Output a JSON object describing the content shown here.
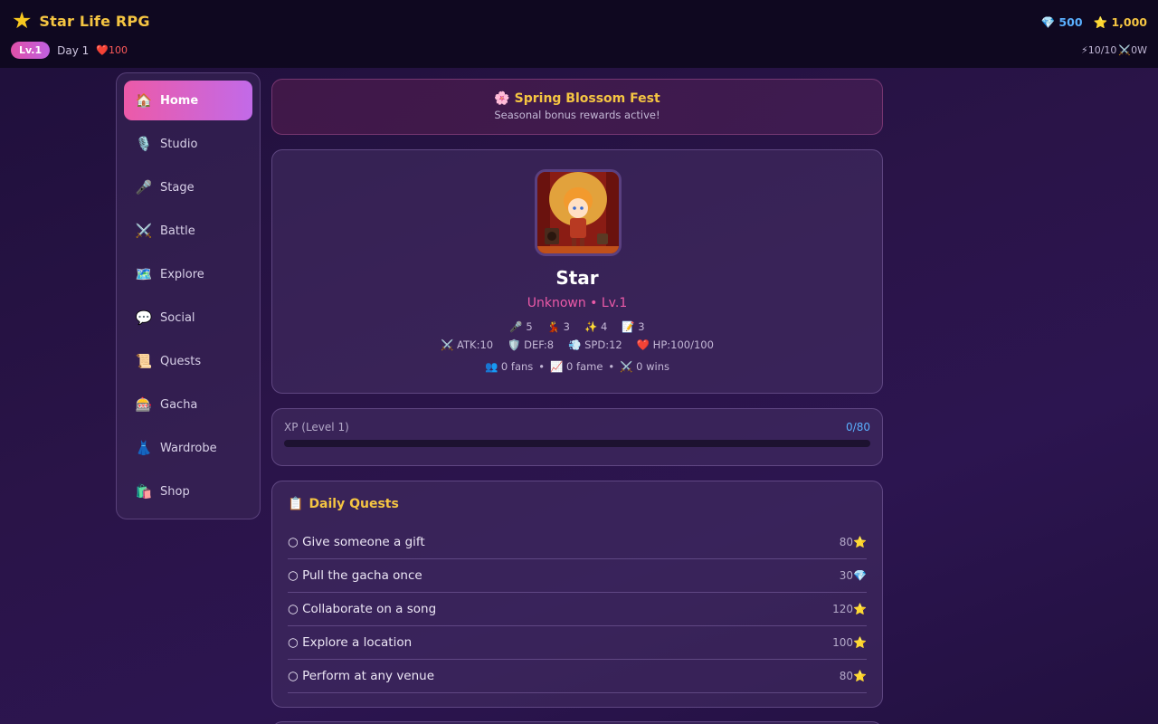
{
  "header": {
    "brand_icon": "star-icon",
    "title": "Star Life RPG",
    "gems": "💎 500",
    "stars": "⭐ 1,000",
    "level": "Lv.1",
    "day": "Day 1",
    "hp": "❤️100",
    "energy": "⚡10/10",
    "wins": "⚔️0W"
  },
  "sidebar": {
    "items": [
      {
        "icon": "🏠",
        "label": "Home",
        "active": true
      },
      {
        "icon": "🎙️",
        "label": "Studio"
      },
      {
        "icon": "🎤",
        "label": "Stage"
      },
      {
        "icon": "⚔️",
        "label": "Battle"
      },
      {
        "icon": "🗺️",
        "label": "Explore"
      },
      {
        "icon": "💬",
        "label": "Social"
      },
      {
        "icon": "📜",
        "label": "Quests"
      },
      {
        "icon": "🎰",
        "label": "Gacha"
      },
      {
        "icon": "👗",
        "label": "Wardrobe"
      },
      {
        "icon": "🛍️",
        "label": "Shop"
      }
    ]
  },
  "event": {
    "title": "🌸 Spring Blossom Fest",
    "subtitle": "Seasonal bonus rewards active!"
  },
  "profile": {
    "name": "Star",
    "class_line": "Unknown • Lv.1",
    "skills": [
      "🎤 5",
      "💃 3",
      "✨ 4",
      "📝 3"
    ],
    "combat": [
      "⚔️ ATK:10",
      "🛡️ DEF:8",
      "💨 SPD:12",
      "❤️ HP:100/100"
    ],
    "social": [
      "👥 0 fans",
      "•",
      "📈 0 fame",
      "•",
      "⚔️ 0 wins"
    ]
  },
  "xp": {
    "label": "XP (Level 1)",
    "value": "0/80",
    "progress": 0
  },
  "quests": {
    "title_icon": "📋",
    "title": "Daily Quests",
    "items": [
      {
        "label": "○ Give someone a gift",
        "reward": "80⭐"
      },
      {
        "label": "○ Pull the gacha once",
        "reward": "30💎"
      },
      {
        "label": "○ Collaborate on a song",
        "reward": "120⭐"
      },
      {
        "label": "○ Explore a location",
        "reward": "100⭐"
      },
      {
        "label": "○ Perform at any venue",
        "reward": "80⭐"
      }
    ]
  },
  "colors": {
    "accent_pink": "#ec5aa8",
    "accent_gold": "#f5c542",
    "accent_blue": "#5ab0ff"
  }
}
